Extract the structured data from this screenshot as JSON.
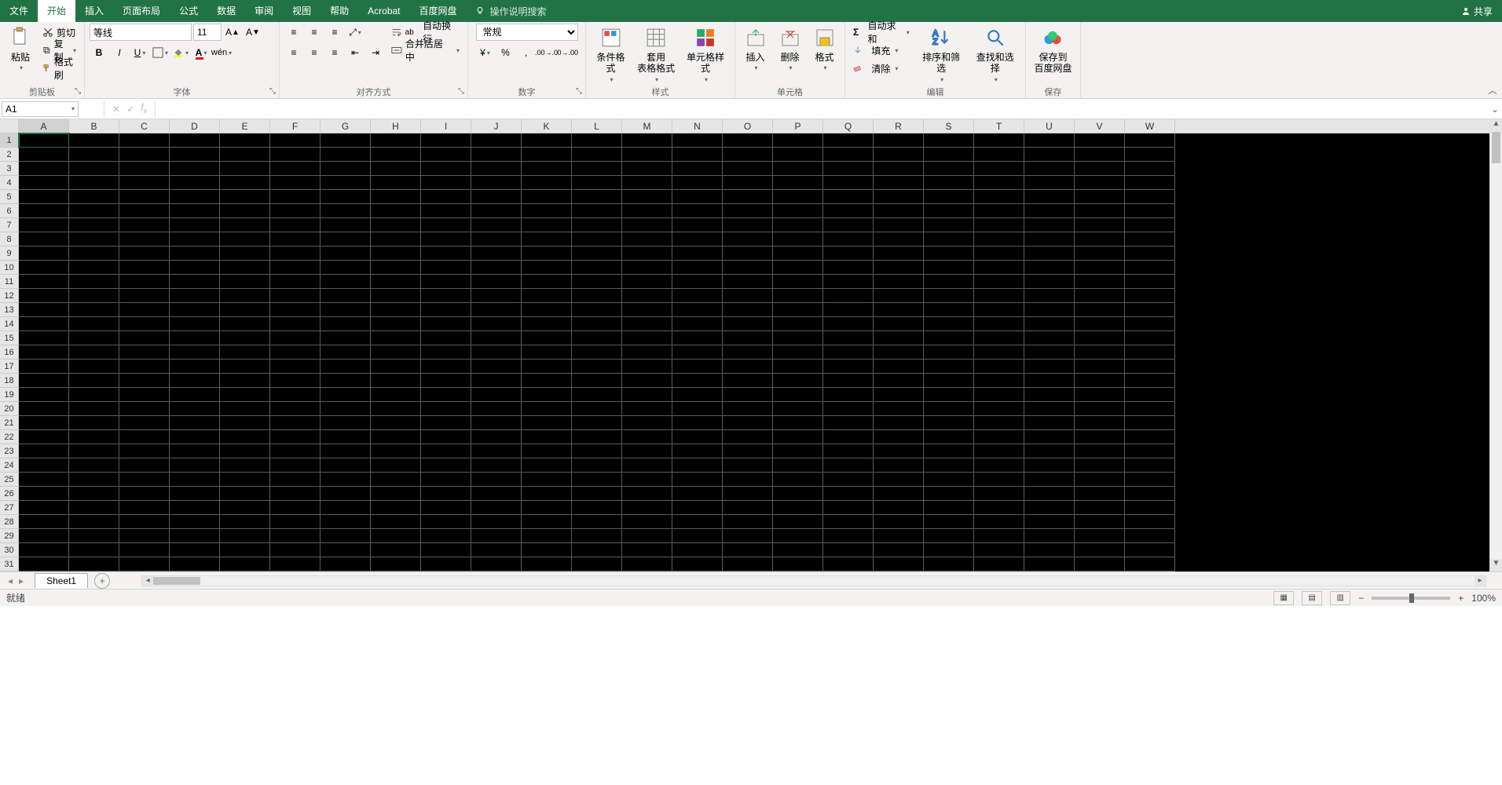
{
  "tabs": [
    "文件",
    "开始",
    "插入",
    "页面布局",
    "公式",
    "数据",
    "审阅",
    "视图",
    "帮助",
    "Acrobat",
    "百度网盘"
  ],
  "active_tab": "开始",
  "tell_me": "操作说明搜索",
  "share": "共享",
  "clipboard": {
    "label": "剪贴板",
    "paste": "粘贴",
    "cut": "剪切",
    "copy": "复制",
    "painter": "格式刷"
  },
  "font": {
    "label": "字体",
    "name": "等线",
    "size": "11"
  },
  "align": {
    "label": "对齐方式",
    "wrap": "自动换行",
    "merge": "合并后居中"
  },
  "number": {
    "label": "数字",
    "format": "常规"
  },
  "styles": {
    "label": "样式",
    "cond": "条件格式",
    "table": "套用\n表格格式",
    "cell": "单元格样式"
  },
  "cells_grp": {
    "label": "单元格",
    "insert": "插入",
    "delete": "删除",
    "format": "格式"
  },
  "editing": {
    "label": "编辑",
    "sum": "自动求和",
    "fill": "填充",
    "clear": "清除",
    "sort": "排序和筛选",
    "find": "查找和选择"
  },
  "save": {
    "label": "保存",
    "baidu": "保存到\n百度网盘"
  },
  "name_box": "A1",
  "formula": "",
  "columns": [
    "A",
    "B",
    "C",
    "D",
    "E",
    "F",
    "G",
    "H",
    "I",
    "J",
    "K",
    "L",
    "M",
    "N",
    "O",
    "P",
    "Q",
    "R",
    "S",
    "T",
    "U",
    "V",
    "W"
  ],
  "row_count": 31,
  "selected_cell": {
    "col": 0,
    "row": 0
  },
  "sheet": "Sheet1",
  "status_text": "就绪",
  "zoom": "100%"
}
